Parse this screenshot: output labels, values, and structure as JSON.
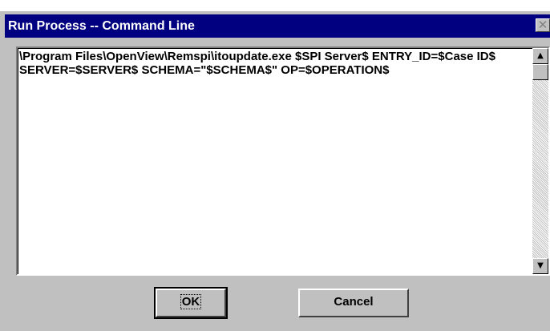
{
  "window": {
    "title": "Run Process -- Command Line",
    "close_glyph": "✕"
  },
  "command_field": {
    "value": "\\Program Files\\OpenView\\Remspi\\itoupdate.exe $SPI Server$ ENTRY_ID=$Case ID$ SERVER=$SERVER$ SCHEMA=\"$SCHEMA$\" OP=$OPERATION$"
  },
  "scrollbar": {
    "up_glyph": "▲",
    "down_glyph": "▼"
  },
  "buttons": {
    "ok_label": "OK",
    "cancel_label": "Cancel"
  }
}
